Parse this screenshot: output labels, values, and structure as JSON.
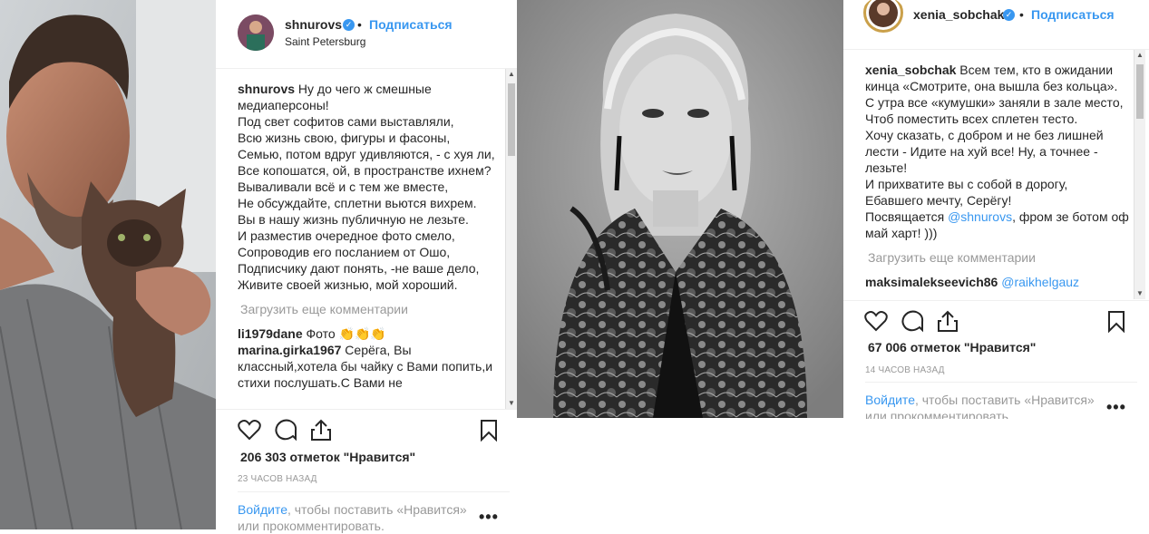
{
  "post1": {
    "username": "shnurovs",
    "dot": "•",
    "follow_label": "Подписаться",
    "location": "Saint Petersburg",
    "caption_user": "shnurovs",
    "caption_text": "Ну до чего ж смешные медиаперсоны!\nПод свет софитов сами выставляли,\nВсю жизнь свою, фигуры и фасоны,\nСемью, потом вдруг удивляются, - с хуя ли,\nВсе копошатся, ой, в пространстве ихнем?\nВываливали всё и с тем же вместе,\nНе обсуждайте, сплетни вьются вихрем.\nВы в нашу жизнь публичную не лезьте.\nИ разместив очередное фото смело,\nСопроводив его посланием от Ошо,\nПодписчику дают понять, -не ваше дело,\nЖивите своей жизнью, мой хороший.",
    "load_more": "Загрузить еще комментарии",
    "comments": [
      {
        "user": "li1979dane",
        "text": "Фото 👏👏👏"
      },
      {
        "user": "marina.girka1967",
        "text": "Серёга, Вы классный,хотела бы чайку с Вами попить,и стихи послушать.С Вами не"
      }
    ],
    "likes": "206 303 отметок \"Нравится\"",
    "time": "23 ЧАСОВ НАЗАД",
    "login_link": "Войдите",
    "login_rest": ", чтобы поставить «Нравится» или прокомментировать.",
    "more_dots": "•••"
  },
  "post2": {
    "username": "xenia_sobchak",
    "dot": "•",
    "follow_label": "Подписаться",
    "caption_user": "xenia_sobchak",
    "caption_text": "Всем тем, кто в ожидании кинца «Смотрите, она вышла без кольца».\nС утра все «кумушки» заняли в зале место,\nЧтоб поместить всех сплетен тесто.\nХочу сказать, с добром и не без лишней лести - Идите на хуй все! Ну, а точнее - лезьте!\nИ прихватите вы с собой в дорогу,\nЕбавшего мечту, Серёгу!\nПосвящается ",
    "mention": "@shnurovs",
    "caption_tail": ", фром зе ботом оф май харт! )))",
    "load_more": "Загрузить еще комментарии",
    "comments": [
      {
        "user": "maksimalekseevich86",
        "mention": "@raikhelgauz"
      }
    ],
    "likes": "67 006 отметок \"Нравится\"",
    "time": "14 ЧАСОВ НАЗАД",
    "login_link": "Войдите",
    "login_rest": ", чтобы поставить «Нравится» или прокомментировать.",
    "more_dots": "•••"
  },
  "icons": [
    "heart-icon",
    "comment-icon",
    "share-icon",
    "bookmark-icon",
    "verified-icon"
  ],
  "colors": {
    "link": "#3897f0",
    "muted": "#999999",
    "text": "#262626",
    "verified": "#3897f0"
  }
}
